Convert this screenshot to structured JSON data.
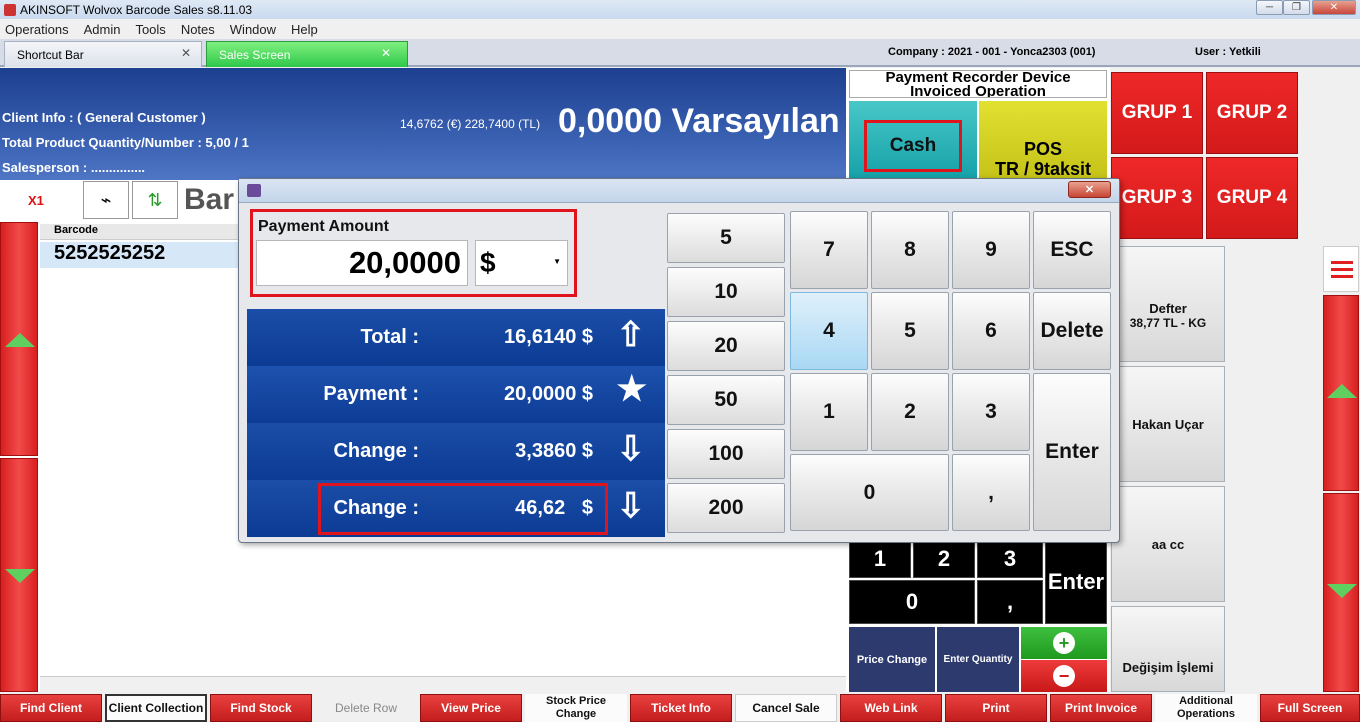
{
  "window": {
    "title": "AKINSOFT Wolvox Barcode Sales s8.11.03"
  },
  "menu": [
    "Operations",
    "Admin",
    "Tools",
    "Notes",
    "Window",
    "Help"
  ],
  "tabs": [
    {
      "label": "Shortcut Bar"
    },
    {
      "label": "Sales Screen"
    }
  ],
  "company": "Company : 2021 - 001 - Yonca2303 (001)",
  "user": "User : Yetkili",
  "header": {
    "client_info": "Client Info : ( General Customer )",
    "total_qty": "Total Product Quantity/Number : 5,00 / 1",
    "salesperson": "Salesperson : ...............",
    "rates": "14,6762 (€) 228,7400 (TL)",
    "amount": "0,0000 Varsayılan"
  },
  "toolbar": {
    "multiplier": "X1",
    "bar_label": "Bar"
  },
  "grid": {
    "col_barcode": "Barcode",
    "row_barcode": "5252525252"
  },
  "right_panel": {
    "device_line1": "Payment Recorder Device",
    "device_line2": "Invoiced Operation",
    "cash": "Cash",
    "pos_line1": "POS",
    "pos_line2": "TR / 9taksit",
    "grups": [
      "GRUP 1",
      "GRUP 2",
      "GRUP 3",
      "GRUP 4"
    ],
    "defter_title": "Defter",
    "defter_sub": "38,77 TL  -  KG",
    "hakan": "Hakan Uçar",
    "aacc": "aa cc",
    "degisim": "Değişim İşlemi",
    "price_change": "Price Change",
    "enter_quantity": "Enter Quantity",
    "bk": {
      "k1": "1",
      "k2": "2",
      "k3": "3",
      "k0": "0",
      "kcomma": ",",
      "enter": "Enter"
    }
  },
  "bottom_bar": [
    "Find Client",
    "Client Collection",
    "Find Stock",
    "Delete Row",
    "View Price",
    "Stock Price Change",
    "Ticket Info",
    "Cancel Sale",
    "Web Link",
    "Print",
    "Print Invoice",
    "Additional Operations",
    "Full Screen"
  ],
  "dialog": {
    "payment_amount_label": "Payment Amount",
    "payment_amount_value": "20,0000",
    "currency": "$",
    "rows": [
      {
        "label": "Total :",
        "value": "16,6140 $"
      },
      {
        "label": "Payment :",
        "value": "20,0000 $"
      },
      {
        "label": "Change :",
        "value": "3,3860 $"
      },
      {
        "label": "Change :",
        "value": "46,62   $"
      }
    ],
    "quick_amounts": [
      "5",
      "10",
      "20",
      "50",
      "100",
      "200"
    ],
    "keypad": {
      "k7": "7",
      "k8": "8",
      "k9": "9",
      "esc": "ESC",
      "k4": "4",
      "k5": "5",
      "k6": "6",
      "del": "Delete",
      "k1": "1",
      "k2": "2",
      "k3": "3",
      "enter": "Enter",
      "k0": "0",
      "comma": ","
    }
  }
}
